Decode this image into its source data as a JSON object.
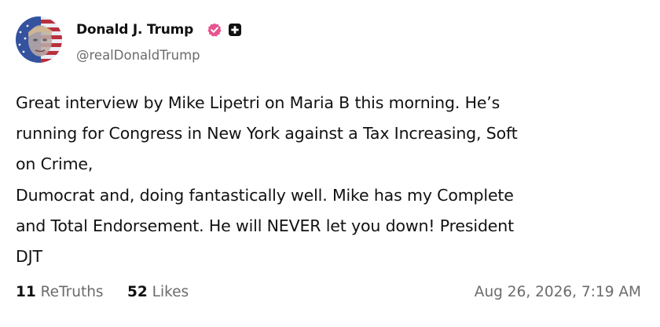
{
  "author": {
    "display_name": "Donald J. Trump",
    "handle": "@realDonaldTrump",
    "verified_color": "#e8548f",
    "badge_icon": "plus-badge-icon"
  },
  "post": {
    "lines": [
      "Great interview by Mike Lipetri on Maria B this morning. He’s",
      "running for Congress in New York against a Tax Increasing, Soft",
      "on Crime,",
      "Dumocrat and, doing fantastically well. Mike has my Complete",
      "and Total Endorsement. He will NEVER let you down! President",
      "DJT"
    ]
  },
  "stats": {
    "retruths_count": "11",
    "retruths_label": "ReTruths",
    "likes_count": "52",
    "likes_label": "Likes"
  },
  "timestamp": "Aug 26, 2026, 7:19 AM"
}
